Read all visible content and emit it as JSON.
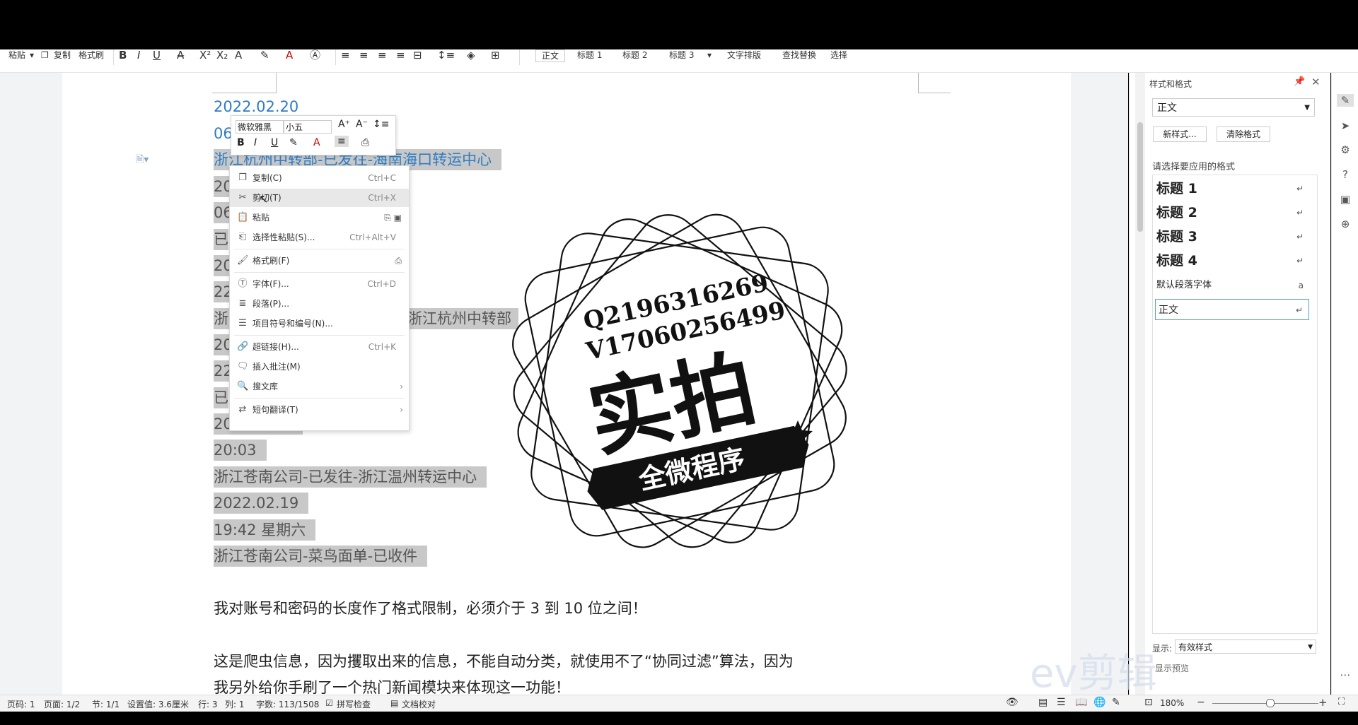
{
  "toolbar": {
    "paste": "粘贴",
    "copy": "复制",
    "format_painter": "格式刷",
    "bold": "B",
    "italic": "I",
    "underline": "U",
    "style_normal": "正文",
    "style_h1": "标题 1",
    "style_h2": "标题 2",
    "style_h3": "标题 3",
    "text_layout": "文字排版",
    "find_replace": "查找替换",
    "select": "选择"
  },
  "document": {
    "lines": [
      "2022.02.20",
      "06",
      "浙江杭州中转部-已发往-海南海口转运中心",
      "20",
      "06",
      "已",
      "20",
      "22",
      "浙江杭州中转部",
      "20",
      "22",
      "已",
      "20",
      "20:03",
      "浙江苍南公司-已发往-浙江温州转运中心",
      "2022.02.19",
      "19:42  星期六",
      "浙江苍南公司-菜鸟面单-已收件",
      "我对账号和密码的长度作了格式限制，必须介于 3 到 10 位之间！",
      "这是爬虫信息，因为攫取出来的信息，不能自动分类，就使用不了“协同过滤”算法，因为",
      "我另外给你手刷了一个热门新闻模块来体现这一功能！"
    ],
    "line_8_prefix": "浙"
  },
  "mini_toolbar": {
    "font_name": "微软雅黑",
    "font_size": "小五"
  },
  "context_menu": {
    "items": [
      {
        "label": "复制(C)",
        "shortcut": "Ctrl+C"
      },
      {
        "label": "剪切(T)",
        "shortcut": "Ctrl+X"
      },
      {
        "label": "粘贴",
        "shortcut": ""
      },
      {
        "label": "选择性粘贴(S)...",
        "shortcut": "Ctrl+Alt+V"
      },
      {
        "label": "格式刷(F)",
        "shortcut": ""
      },
      {
        "label": "字体(F)...",
        "shortcut": "Ctrl+D"
      },
      {
        "label": "段落(P)...",
        "shortcut": ""
      },
      {
        "label": "项目符号和编号(N)...",
        "shortcut": ""
      },
      {
        "label": "超链接(H)...",
        "shortcut": "Ctrl+K"
      },
      {
        "label": "插入批注(M)",
        "shortcut": ""
      },
      {
        "label": "搜文库",
        "shortcut": ""
      },
      {
        "label": "短句翻译(T)",
        "shortcut": ""
      }
    ]
  },
  "stamp": {
    "line1": "Q2196316269",
    "line2": "V17060256499",
    "main": "实拍",
    "banner": "全微程序"
  },
  "right_panel": {
    "title": "样式和格式",
    "current_style": "正文",
    "new_style": "新样式...",
    "clear_format": "清除格式",
    "prompt": "请选择要应用的格式",
    "styles": [
      "标题 1",
      "标题 2",
      "标题 3",
      "标题 4"
    ],
    "default_font": "默认段落字体",
    "normal": "正文",
    "show_label": "显示:",
    "show_value": "有效样式",
    "preview": "显示预览"
  },
  "status_bar": {
    "page": "页码: 1",
    "pages": "页面: 1/2",
    "section": "节: 1/1",
    "setting": "设置值: 3.6厘米",
    "row": "行: 3",
    "col": "列: 1",
    "words": "字数: 113/1508",
    "spell": "拼写检查",
    "proof": "文档校对",
    "zoom": "180%"
  },
  "watermark": "ev剪辑"
}
